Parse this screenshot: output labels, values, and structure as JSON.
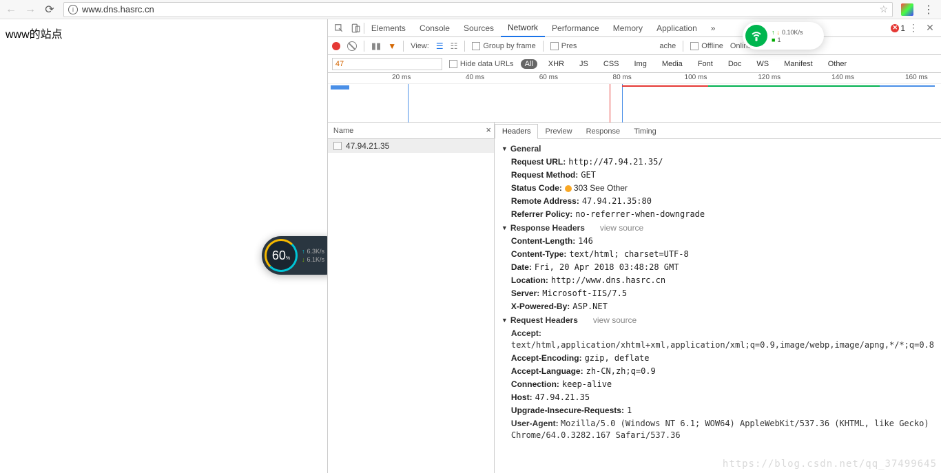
{
  "browser": {
    "url": "www.dns.hasrc.cn"
  },
  "page": {
    "title": "www的站点"
  },
  "speed_widget": {
    "percent": "60",
    "percent_suffix": "%",
    "up": "6.3K/s",
    "down": "6.1K/s"
  },
  "wifi_overlay": {
    "rate": "0.10K/s",
    "count": "1"
  },
  "devtools": {
    "tabs": [
      "Elements",
      "Console",
      "Sources",
      "Network",
      "Performance",
      "Memory",
      "Application"
    ],
    "active_tab": "Network",
    "more": "»",
    "error_count": "1",
    "toolbar": {
      "view": "View:",
      "group_by_frame": "Group by frame",
      "preserve": "Pres",
      "cache": "ache",
      "offline": "Offline",
      "online": "Online"
    },
    "filter": {
      "value": "47",
      "hide_data_urls": "Hide data URLs",
      "pills": [
        "All",
        "XHR",
        "JS",
        "CSS",
        "Img",
        "Media",
        "Font",
        "Doc",
        "WS",
        "Manifest",
        "Other"
      ]
    },
    "timeline_ticks": [
      "20 ms",
      "40 ms",
      "60 ms",
      "80 ms",
      "100 ms",
      "120 ms",
      "140 ms",
      "160 ms"
    ],
    "request_list": {
      "header": "Name",
      "items": [
        "47.94.21.35"
      ]
    },
    "detail_tabs": [
      "Headers",
      "Preview",
      "Response",
      "Timing"
    ],
    "headers": {
      "general": {
        "title": "General",
        "request_url_k": "Request URL:",
        "request_url_v": "http://47.94.21.35/",
        "request_method_k": "Request Method:",
        "request_method_v": "GET",
        "status_code_k": "Status Code:",
        "status_code_v": "303 See Other",
        "remote_address_k": "Remote Address:",
        "remote_address_v": "47.94.21.35:80",
        "referrer_policy_k": "Referrer Policy:",
        "referrer_policy_v": "no-referrer-when-downgrade"
      },
      "response": {
        "title": "Response Headers",
        "view_source": "view source",
        "items": [
          {
            "k": "Content-Length:",
            "v": "146"
          },
          {
            "k": "Content-Type:",
            "v": "text/html; charset=UTF-8"
          },
          {
            "k": "Date:",
            "v": "Fri, 20 Apr 2018 03:48:28 GMT"
          },
          {
            "k": "Location:",
            "v": "http://www.dns.hasrc.cn"
          },
          {
            "k": "Server:",
            "v": "Microsoft-IIS/7.5"
          },
          {
            "k": "X-Powered-By:",
            "v": "ASP.NET"
          }
        ]
      },
      "request": {
        "title": "Request Headers",
        "view_source": "view source",
        "accept_k": "Accept:",
        "accept_v": "text/html,application/xhtml+xml,application/xml;q=0.9,image/webp,image/apng,*/*;q=0.8",
        "items": [
          {
            "k": "Accept-Encoding:",
            "v": "gzip, deflate"
          },
          {
            "k": "Accept-Language:",
            "v": "zh-CN,zh;q=0.9"
          },
          {
            "k": "Connection:",
            "v": "keep-alive"
          },
          {
            "k": "Host:",
            "v": "47.94.21.35"
          },
          {
            "k": "Upgrade-Insecure-Requests:",
            "v": "1"
          }
        ],
        "ua_k": "User-Agent:",
        "ua_v": "Mozilla/5.0 (Windows NT 6.1; WOW64) AppleWebKit/537.36 (KHTML, like Gecko) Chrome/64.0.3282.167 Safari/537.36"
      }
    }
  },
  "watermark": "https://blog.csdn.net/qq_37499645"
}
